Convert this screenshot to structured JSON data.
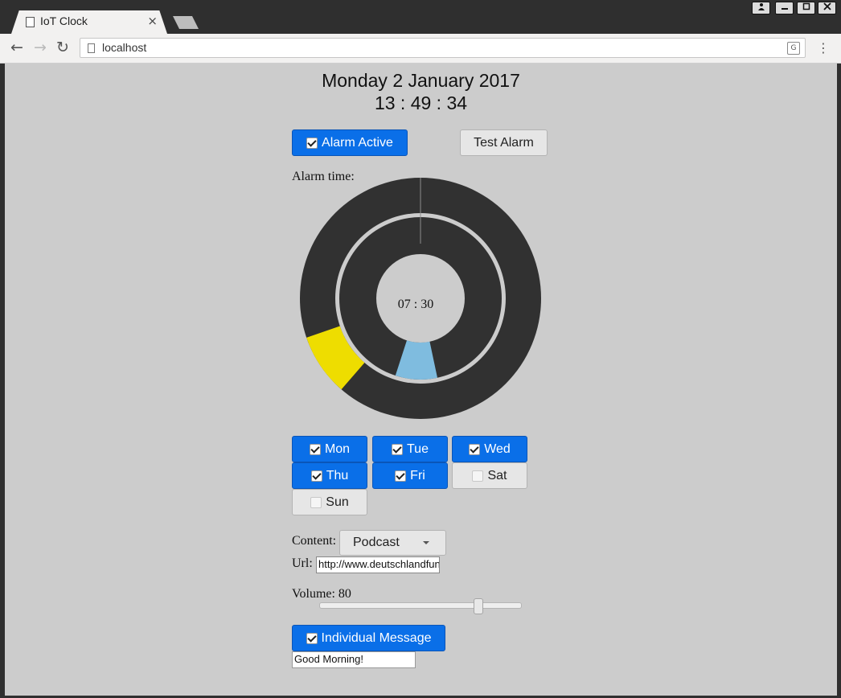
{
  "browser": {
    "tab_title": "IoT Clock",
    "tab_close": "×",
    "url": "localhost",
    "window_buttons": {
      "user": "👤",
      "minimize": "—",
      "maximize": "□",
      "close": "✕"
    },
    "nav": {
      "back": "←",
      "forward": "→",
      "reload": "↻",
      "menu": "⋮"
    },
    "translate_glyph": "G"
  },
  "clock": {
    "date": "Monday 2 January 2017",
    "time": "13 : 49 : 34"
  },
  "controls": {
    "alarm_active_label": "Alarm Active",
    "alarm_active_checked": true,
    "test_alarm_label": "Test Alarm"
  },
  "alarm": {
    "label": "Alarm time:",
    "display": "07 : 30",
    "hour": 7,
    "minute": 30,
    "colors": {
      "ring": "#313131",
      "separator": "#cccccc",
      "minute_marker": "#eedd00",
      "hour_marker": "#7fbcdf",
      "center": "#cccccc"
    }
  },
  "days": [
    {
      "label": "Mon",
      "checked": true
    },
    {
      "label": "Tue",
      "checked": true
    },
    {
      "label": "Wed",
      "checked": true
    },
    {
      "label": "Thu",
      "checked": true
    },
    {
      "label": "Fri",
      "checked": true
    },
    {
      "label": "Sat",
      "checked": false
    },
    {
      "label": "Sun",
      "checked": false
    }
  ],
  "content": {
    "label": "Content:",
    "selected": "Podcast",
    "url_label": "Url:",
    "url_value": "http://www.deutschlandfun"
  },
  "volume": {
    "label": "Volume: 80",
    "value": 80,
    "max": 100
  },
  "message": {
    "toggle_label": "Individual Message",
    "toggle_checked": true,
    "text": "Good Morning!"
  },
  "theme": {
    "accent": "#0a6fe8",
    "page_bg": "#cccccc"
  }
}
